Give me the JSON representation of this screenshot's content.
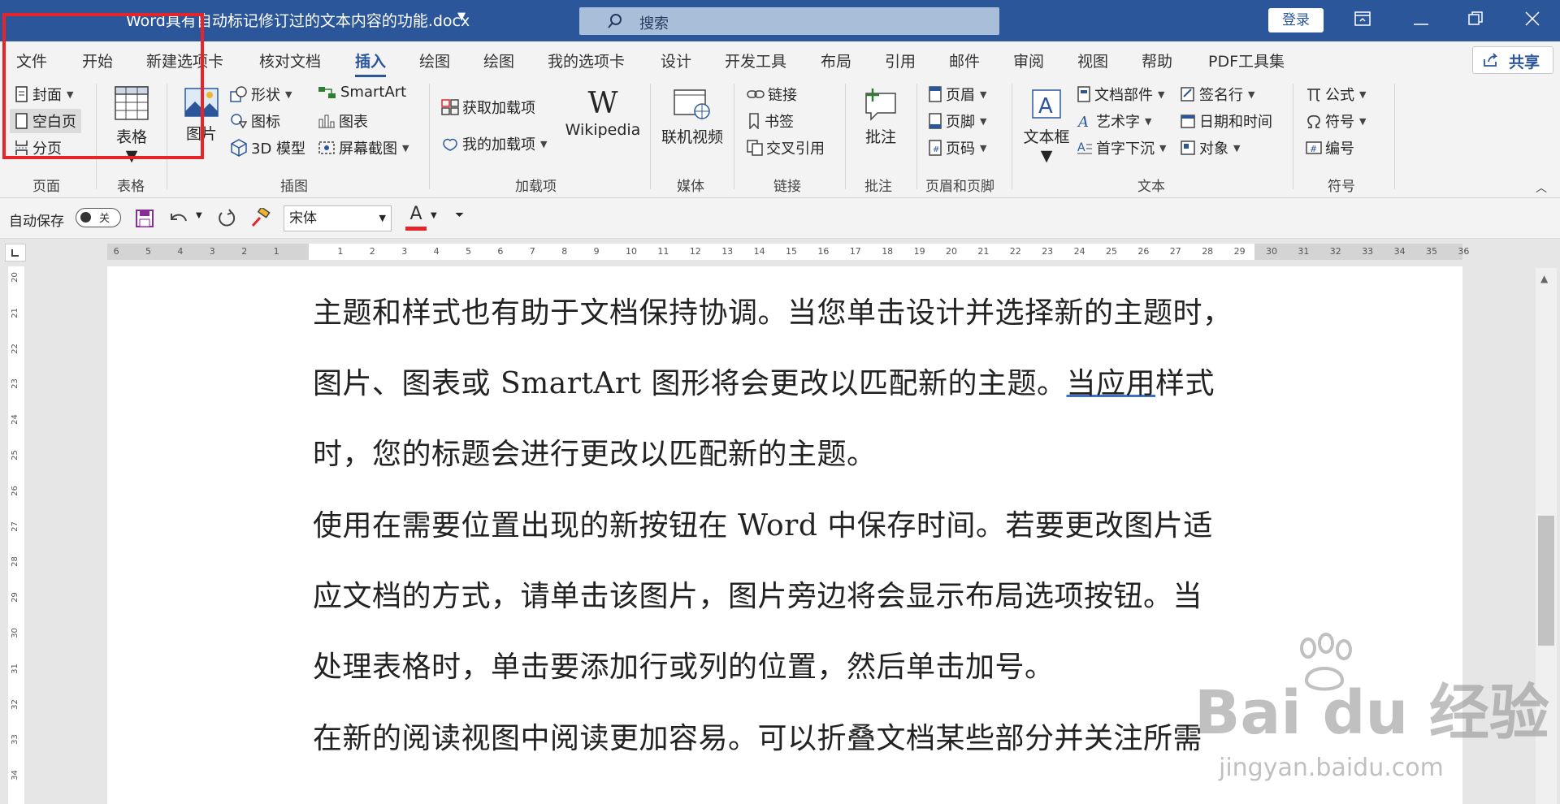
{
  "titlebar": {
    "doc_title": "Word具有自动标记修订过的文本内容的功能.docx",
    "search_label": "搜索",
    "login_label": "登录"
  },
  "tabs": {
    "file": "文件",
    "home": "开始",
    "new_tab": "新建选项卡",
    "review_doc": "核对文档",
    "insert": "插入",
    "draw1": "绘图",
    "draw2": "绘图",
    "my_tab": "我的选项卡",
    "design": "设计",
    "developer": "开发工具",
    "layout": "布局",
    "references": "引用",
    "mailings": "邮件",
    "review": "审阅",
    "view": "视图",
    "help": "帮助",
    "pdf": "PDF工具集",
    "share": "共享"
  },
  "ribbon": {
    "pages": {
      "cover": "封面",
      "blank": "空白页",
      "page_break": "分页",
      "group": "页面"
    },
    "tables": {
      "table": "表格",
      "group": "表格"
    },
    "illustrations": {
      "picture": "图片",
      "shapes": "形状",
      "icons": "图标",
      "model3d": "3D 模型",
      "smartart": "SmartArt",
      "chart": "图表",
      "screenshot": "屏幕截图",
      "group": "插图"
    },
    "addins": {
      "get": "获取加载项",
      "my": "我的加载项",
      "wikipedia": "Wikipedia",
      "group": "加载项"
    },
    "media": {
      "online_video": "联机视频",
      "group": "媒体"
    },
    "links": {
      "link": "链接",
      "bookmark": "书签",
      "cross_ref": "交叉引用",
      "group": "链接"
    },
    "comments": {
      "comment": "批注",
      "group": "批注"
    },
    "header_footer": {
      "header": "页眉",
      "footer": "页脚",
      "page_number": "页码",
      "group": "页眉和页脚"
    },
    "text": {
      "textbox": "文本框",
      "quick_parts": "文档部件",
      "wordart": "艺术字",
      "dropcap": "首字下沉",
      "signature": "签名行",
      "datetime": "日期和时间",
      "object": "对象",
      "group": "文本"
    },
    "symbols": {
      "equation": "公式",
      "symbol": "符号",
      "number": "编号",
      "group": "符号"
    }
  },
  "qat": {
    "autosave": "自动保存",
    "toggle_state": "关",
    "font_name": "宋体",
    "font_color_glyph": "A",
    "font_color": "#e8242b"
  },
  "ruler": {
    "left_numbers": [
      "6",
      "5",
      "4",
      "3",
      "2",
      "1"
    ],
    "right_numbers": [
      "1",
      "2",
      "3",
      "4",
      "5",
      "6",
      "7",
      "8",
      "9",
      "10",
      "11",
      "12",
      "13",
      "14",
      "15",
      "16",
      "17",
      "18",
      "19",
      "20",
      "21",
      "22",
      "23",
      "24",
      "25",
      "26",
      "27",
      "28",
      "29",
      "30",
      "31",
      "32",
      "33",
      "34",
      "35",
      "36"
    ],
    "vertical_numbers": [
      "20",
      "21",
      "22",
      "23",
      "24",
      "25",
      "26",
      "27",
      "28",
      "29",
      "30",
      "31",
      "32",
      "33",
      "34"
    ]
  },
  "document": {
    "lines": [
      "主题和样式也有助于文档保持协调。当您单击设计并选择新的主题时，",
      "图片、图表或 SmartArt 图形将会更改以匹配新的主题。",
      "时，您的标题会进行更改以匹配新的主题。",
      "使用在需要位置出现的新按钮在 Word 中保存时间。若要更改图片适",
      "应文档的方式，请单击该图片，图片旁边将会显示布局选项按钮。当",
      "处理表格时，单击要添加行或列的位置，然后单击加号。",
      "在新的阅读视图中阅读更加容易。可以折叠文档某些部分并关注所需"
    ],
    "underlined": "当应用",
    "line2_tail": "样式"
  },
  "watermark": {
    "main": "Bai du 经验",
    "sub": "jingyan.baidu.com"
  },
  "colors": {
    "title_blue": "#2b579a",
    "highlight_red": "#e8242b"
  }
}
